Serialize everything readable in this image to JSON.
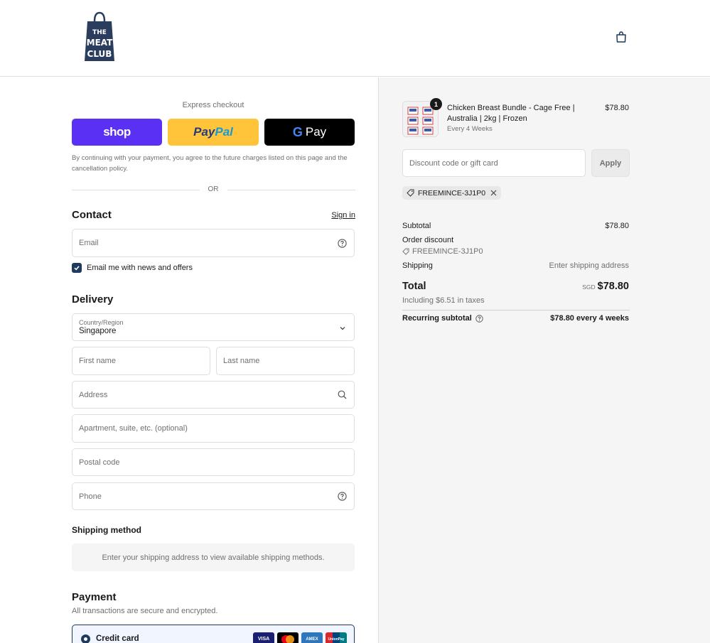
{
  "brand": {
    "logo_lines": [
      "THE",
      "MEAT",
      "CLUB"
    ]
  },
  "express": {
    "title": "Express checkout",
    "shop_label": "shop",
    "paypal_label_1": "Pay",
    "paypal_label_2": "Pal",
    "gpay_label": "Pay",
    "consent": "By continuing with your payment, you agree to the future charges listed on this page and the cancellation policy.",
    "or": "OR"
  },
  "contact": {
    "title": "Contact",
    "sign_in": "Sign in",
    "email_placeholder": "Email",
    "newsletter_label": "Email me with news and offers",
    "newsletter_checked": true
  },
  "delivery": {
    "title": "Delivery",
    "country_label": "Country/Region",
    "country_value": "Singapore",
    "first_name": "First name",
    "last_name": "Last name",
    "address": "Address",
    "apartment": "Apartment, suite, etc. (optional)",
    "postal": "Postal code",
    "phone": "Phone"
  },
  "shipping": {
    "title": "Shipping method",
    "placeholder": "Enter your shipping address to view available shipping methods."
  },
  "payment": {
    "title": "Payment",
    "subtitle": "All transactions are secure and encrypted.",
    "credit_card_label": "Credit card",
    "cards": [
      "VISA",
      "MC",
      "AMEX",
      "UnionPay"
    ]
  },
  "summary": {
    "product": {
      "quantity": "1",
      "name": "Chicken Breast Bundle - Cage Free | Australia | 2kg | Frozen",
      "subscription": "Every 4 Weeks",
      "price": "$78.80"
    },
    "discount_placeholder": "Discount code or gift card",
    "apply_label": "Apply",
    "applied_code": "FREEMINCE-3J1P0",
    "subtotal_label": "Subtotal",
    "subtotal_value": "$78.80",
    "order_discount_label": "Order discount",
    "order_discount_code": "FREEMINCE-3J1P0",
    "shipping_label": "Shipping",
    "shipping_value": "Enter shipping address",
    "total_label": "Total",
    "currency": "SGD",
    "total_value": "$78.80",
    "tax_note": "Including $6.51 in taxes",
    "recurring_label": "Recurring subtotal",
    "recurring_value": "$78.80 every 4 weeks"
  },
  "colors": {
    "accent": "#1e3a5f",
    "shop": "#5a31f4",
    "paypal": "#ffc439",
    "right_bg": "#f5f5f5"
  }
}
